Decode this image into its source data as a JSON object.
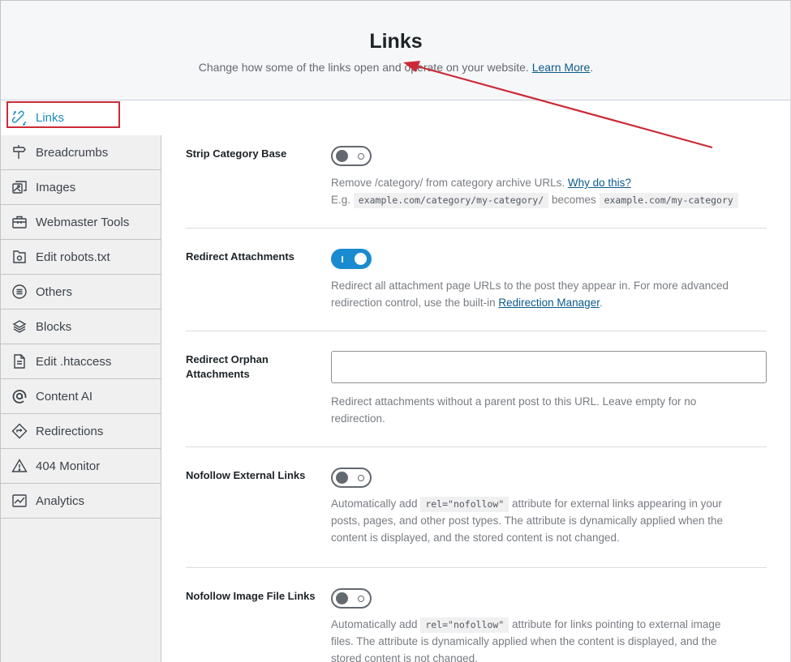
{
  "header": {
    "title": "Links",
    "subtitle": "Change how some of the links open and operate on your website.",
    "learn_more": "Learn More",
    "period": "."
  },
  "sidebar": {
    "items": [
      {
        "label": "Links",
        "icon": "links-icon",
        "active": true
      },
      {
        "label": "Breadcrumbs",
        "icon": "signpost-icon"
      },
      {
        "label": "Images",
        "icon": "images-icon"
      },
      {
        "label": "Webmaster Tools",
        "icon": "toolbox-icon"
      },
      {
        "label": "Edit robots.txt",
        "icon": "robots-file-icon"
      },
      {
        "label": "Others",
        "icon": "list-circle-icon"
      },
      {
        "label": "Blocks",
        "icon": "blocks-icon"
      },
      {
        "label": "Edit .htaccess",
        "icon": "document-icon"
      },
      {
        "label": "Content AI",
        "icon": "content-ai-icon"
      },
      {
        "label": "Redirections",
        "icon": "redirect-diamond-icon"
      },
      {
        "label": "404 Monitor",
        "icon": "warning-triangle-icon"
      },
      {
        "label": "Analytics",
        "icon": "analytics-chart-icon"
      }
    ]
  },
  "settings": {
    "strip_category_base": {
      "label": "Strip Category Base",
      "enabled": false,
      "desc_text": "Remove /category/ from category archive URLs.",
      "desc_link": "Why do this?",
      "example_prefix": "E.g.",
      "example_from": "example.com/category/my-category/",
      "example_mid": "becomes",
      "example_to": "example.com/my-category"
    },
    "redirect_attachments": {
      "label": "Redirect Attachments",
      "enabled": true,
      "desc_line1": "Redirect all attachment page URLs to the post they appear in. For more advanced",
      "desc_line2_prefix": "redirection control, use the built-in",
      "desc_link": "Redirection Manager",
      "desc_suffix": "."
    },
    "redirect_orphan": {
      "label": "Redirect Orphan Attachments",
      "value": "",
      "desc_line1": "Redirect attachments without a parent post to this URL. Leave empty for no",
      "desc_line2": "redirection."
    },
    "nofollow_external": {
      "label": "Nofollow External Links",
      "enabled": false,
      "desc_prefix": "Automatically add",
      "desc_code": "rel=\"nofollow\"",
      "desc_line1_suffix": "attribute for external links appearing in your",
      "desc_line2": "posts, pages, and other post types. The attribute is dynamically applied when the",
      "desc_line3": "content is displayed, and the stored content is not changed."
    },
    "nofollow_image": {
      "label": "Nofollow Image File Links",
      "enabled": false,
      "desc_prefix": "Automatically add",
      "desc_code": "rel=\"nofollow\"",
      "desc_line1_suffix": "attribute for links pointing to external image",
      "desc_line2": "files. The attribute is dynamically applied when the content is displayed, and the",
      "desc_line3": "stored content is not changed."
    }
  },
  "colors": {
    "accent": "#1a8bbf",
    "toggle_on": "#1a8bd1",
    "annotation": "#cc2a36"
  }
}
